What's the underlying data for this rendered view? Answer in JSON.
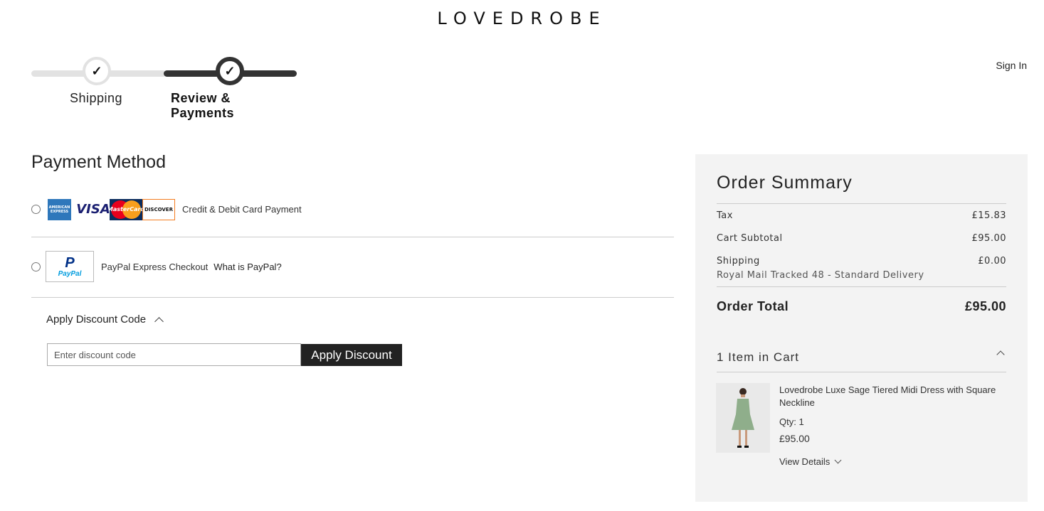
{
  "brand": {
    "logo": "LOVEDROBE"
  },
  "header": {
    "sign_in": "Sign In"
  },
  "progress": {
    "steps": [
      {
        "label": "Shipping",
        "state": "complete"
      },
      {
        "label": "Review & Payments",
        "state": "active"
      }
    ],
    "check_glyph": "✓"
  },
  "payment": {
    "title": "Payment Method",
    "options": [
      {
        "label": "Credit & Debit Card Payment",
        "selected": false,
        "logos": {
          "amex_top": "AMERICAN",
          "amex_bottom": "EXPRESS",
          "visa": "VISA",
          "mastercard": "MasterCard",
          "discover": "DISCOVER"
        }
      },
      {
        "label": "PayPal Express Checkout",
        "selected": false,
        "link": "What is PayPal?",
        "logo_text": "PayPal",
        "logo_letter": "P"
      }
    ]
  },
  "discount": {
    "heading": "Apply Discount Code",
    "placeholder": "Enter discount code",
    "value": "",
    "button": "Apply Discount"
  },
  "summary": {
    "title": "Order Summary",
    "tax_label": "Tax",
    "tax_value": "£15.83",
    "subtotal_label": "Cart Subtotal",
    "subtotal_value": "£95.00",
    "shipping_label": "Shipping",
    "shipping_value": "£0.00",
    "shipping_method": "Royal Mail Tracked 48 - Standard Delivery",
    "total_label": "Order Total",
    "total_value": "£95.00",
    "cart_heading": "1 Item in Cart",
    "items": [
      {
        "name": "Lovedrobe Luxe Sage Tiered Midi Dress with Square Neckline",
        "qty": "Qty: 1",
        "price": "£95.00",
        "details_link": "View Details"
      }
    ]
  },
  "colors": {
    "accent": "#222222",
    "summary_bg": "#f3f3f3",
    "dress": "#8fae8b"
  }
}
